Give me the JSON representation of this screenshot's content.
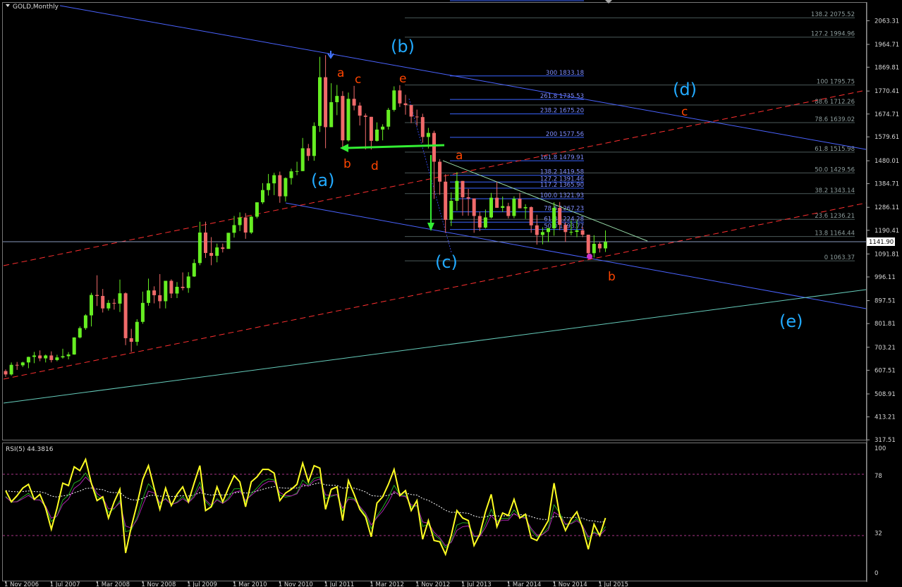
{
  "window": {
    "title": "GOLD,Monthly",
    "current_price": "1141.90",
    "rsi_title": "RSI(5) 44.3816"
  },
  "colors": {
    "background": "#000000",
    "bull_candle": "#66ee22",
    "bear_candle": "#f06a6a",
    "fib_line_grey": "#4b5a5a",
    "fib_line_blue": "#3a64ff",
    "fib_text_grey": "#8c9c9c",
    "fib_text_blue": "#7f8dff",
    "wave_major": "#22aaff",
    "wave_minor": "#ff4500",
    "channel_blue": "#4a63ff",
    "channel_red": "#ff3030",
    "trend_teal": "#66ccbb",
    "green_arrow": "#33ee33",
    "axis_text": "#d8d8d8",
    "rsi_main": "#ffff22",
    "rsi_signal": "#aa22aa",
    "rsi_green": "#22aa22",
    "rsi_level": "#ffdddd",
    "rsi_dotted": "#aa3388"
  },
  "chart_data": [
    {
      "type": "candlestick",
      "title": "GOLD,Monthly",
      "x_tick_labels": [
        "1 Nov 2006",
        "1 Jul 2007",
        "1 Mar 2008",
        "1 Nov 2008",
        "1 Jul 2009",
        "1 Mar 2010",
        "1 Nov 2010",
        "1 Jul 2011",
        "1 Mar 2012",
        "1 Nov 2012",
        "1 Jul 2013",
        "1 Mar 2014",
        "1 Nov 2014",
        "1 Jul 2015"
      ],
      "y_tick_labels": [
        "2063.31",
        "1964.71",
        "1869.81",
        "1770.41",
        "1674.71",
        "1579.61",
        "1480.01",
        "1384.71",
        "1286.11",
        "1190.41",
        "1091.81",
        "996.11",
        "897.51",
        "801.81",
        "703.21",
        "607.51",
        "508.91",
        "413.21",
        "317.51"
      ],
      "ylim": [
        300,
        2150
      ],
      "current_price": 1141.9,
      "ohlc": [
        [
          604,
          611,
          580,
          590
        ],
        [
          590,
          640,
          585,
          630
        ],
        [
          630,
          642,
          609,
          628
        ],
        [
          628,
          643,
          621,
          640
        ],
        [
          640,
          664,
          616,
          663
        ],
        [
          663,
          684,
          637,
          669
        ],
        [
          669,
          690,
          645,
          657
        ],
        [
          657,
          673,
          640,
          669
        ],
        [
          669,
          686,
          640,
          650
        ],
        [
          650,
          672,
          645,
          661
        ],
        [
          661,
          697,
          656,
          666
        ],
        [
          666,
          683,
          653,
          673
        ],
        [
          673,
          745,
          672,
          744
        ],
        [
          744,
          790,
          740,
          783
        ],
        [
          783,
          841,
          776,
          836
        ],
        [
          836,
          930,
          790,
          921
        ],
        [
          921,
          1003,
          875,
          917
        ],
        [
          917,
          946,
          848,
          865
        ],
        [
          865,
          900,
          856,
          888
        ],
        [
          888,
          905,
          860,
          885
        ],
        [
          885,
          985,
          850,
          928
        ],
        [
          928,
          932,
          712,
          741
        ],
        [
          741,
          780,
          684,
          726
        ],
        [
          726,
          820,
          710,
          809
        ],
        [
          809,
          935,
          801,
          888
        ],
        [
          888,
          989,
          876,
          940
        ],
        [
          940,
          957,
          886,
          920
        ],
        [
          920,
          1008,
          865,
          895
        ],
        [
          895,
          955,
          865,
          980
        ],
        [
          980,
          986,
          908,
          927
        ],
        [
          927,
          975,
          908,
          955
        ],
        [
          955,
          1015,
          940,
          950
        ],
        [
          950,
          1016,
          930,
          998
        ],
        [
          998,
          1070,
          996,
          1054
        ],
        [
          1054,
          1226,
          1045,
          1181
        ],
        [
          1181,
          1226,
          1075,
          1096
        ],
        [
          1096,
          1162,
          1045,
          1084
        ],
        [
          1084,
          1135,
          1057,
          1119
        ],
        [
          1119,
          1135,
          1098,
          1113
        ],
        [
          1113,
          1173,
          1113,
          1180
        ],
        [
          1180,
          1250,
          1160,
          1212
        ],
        [
          1212,
          1265,
          1187,
          1244
        ],
        [
          1244,
          1262,
          1155,
          1181
        ],
        [
          1181,
          1250,
          1175,
          1247
        ],
        [
          1247,
          1300,
          1240,
          1307
        ],
        [
          1307,
          1387,
          1300,
          1358
        ],
        [
          1358,
          1425,
          1335,
          1386
        ],
        [
          1386,
          1430,
          1337,
          1420
        ],
        [
          1420,
          1435,
          1305,
          1332
        ],
        [
          1332,
          1411,
          1310,
          1408
        ],
        [
          1408,
          1447,
          1381,
          1436
        ],
        [
          1436,
          1476,
          1420,
          1437
        ],
        [
          1437,
          1575,
          1460,
          1532
        ],
        [
          1532,
          1550,
          1480,
          1500
        ],
        [
          1500,
          1640,
          1480,
          1625
        ],
        [
          1625,
          1913,
          1600,
          1828
        ],
        [
          1828,
          1920,
          1532,
          1620
        ],
        [
          1620,
          1803,
          1625,
          1724
        ],
        [
          1724,
          1796,
          1670,
          1750
        ],
        [
          1750,
          1770,
          1530,
          1565
        ],
        [
          1565,
          1764,
          1560,
          1738
        ],
        [
          1738,
          1792,
          1690,
          1710
        ],
        [
          1710,
          1723,
          1627,
          1668
        ],
        [
          1668,
          1677,
          1527,
          1663
        ],
        [
          1663,
          1650,
          1527,
          1563
        ],
        [
          1563,
          1640,
          1560,
          1610
        ],
        [
          1610,
          1632,
          1565,
          1622
        ],
        [
          1622,
          1700,
          1610,
          1692
        ],
        [
          1692,
          1790,
          1685,
          1773
        ],
        [
          1773,
          1795,
          1704,
          1719
        ],
        [
          1719,
          1755,
          1672,
          1712
        ],
        [
          1712,
          1697,
          1637,
          1664
        ],
        [
          1664,
          1693,
          1626,
          1662
        ],
        [
          1662,
          1676,
          1555,
          1579
        ],
        [
          1579,
          1617,
          1531,
          1596
        ],
        [
          1596,
          1605,
          1321,
          1476
        ],
        [
          1476,
          1487,
          1338,
          1393
        ],
        [
          1393,
          1424,
          1180,
          1234
        ],
        [
          1234,
          1348,
          1208,
          1313
        ],
        [
          1313,
          1433,
          1272,
          1396
        ],
        [
          1396,
          1361,
          1251,
          1328
        ],
        [
          1328,
          1363,
          1251,
          1323
        ],
        [
          1323,
          1293,
          1180,
          1250
        ],
        [
          1250,
          1268,
          1187,
          1202
        ],
        [
          1202,
          1277,
          1198,
          1244
        ],
        [
          1244,
          1346,
          1240,
          1326
        ],
        [
          1326,
          1392,
          1321,
          1284
        ],
        [
          1284,
          1331,
          1267,
          1291
        ],
        [
          1291,
          1305,
          1240,
          1250
        ],
        [
          1250,
          1332,
          1241,
          1322
        ],
        [
          1322,
          1346,
          1291,
          1282
        ],
        [
          1282,
          1299,
          1238,
          1287
        ],
        [
          1287,
          1290,
          1180,
          1211
        ],
        [
          1211,
          1255,
          1131,
          1171
        ],
        [
          1171,
          1203,
          1132,
          1183
        ],
        [
          1183,
          1200,
          1141,
          1199
        ],
        [
          1199,
          1307,
          1168,
          1284
        ],
        [
          1284,
          1308,
          1191,
          1213
        ],
        [
          1213,
          1224,
          1142,
          1183
        ],
        [
          1183,
          1232,
          1170,
          1184
        ],
        [
          1184,
          1232,
          1162,
          1190
        ],
        [
          1190,
          1205,
          1162,
          1172
        ],
        [
          1172,
          1105,
          1077,
          1095
        ],
        [
          1095,
          1170,
          1077,
          1134
        ],
        [
          1134,
          1141,
          1098,
          1115
        ],
        [
          1115,
          1190,
          1100,
          1142
        ]
      ],
      "fibonacci_upper_right": [
        {
          "pct": "138.2",
          "price": "2075.52"
        },
        {
          "pct": "127.2",
          "price": "1994.96"
        },
        {
          "pct": "100",
          "price": "1795.75"
        },
        {
          "pct": "88.6",
          "price": "1712.26"
        },
        {
          "pct": "78.6",
          "price": "1639.02"
        },
        {
          "pct": "61.8",
          "price": "1515.98"
        },
        {
          "pct": "50.0",
          "price": "1429.56"
        },
        {
          "pct": "38.2",
          "price": "1343.14"
        },
        {
          "pct": "23.6",
          "price": "1236.21"
        },
        {
          "pct": "13.8",
          "price": "1164.44"
        },
        {
          "pct": "0",
          "price": "1063.37"
        }
      ],
      "fibonacci_extensions": [
        {
          "pct": "300",
          "price": "1833.18"
        },
        {
          "pct": "261.8",
          "price": "1735.53"
        },
        {
          "pct": "238.2",
          "price": "1675.20"
        },
        {
          "pct": "200",
          "price": "1577.56"
        },
        {
          "pct": "161.8",
          "price": "1479.91"
        },
        {
          "pct": "138.2",
          "price": "1419.58"
        },
        {
          "pct": "127.2",
          "price": "1391.46"
        },
        {
          "pct": "117.2",
          "price": "1365.90"
        },
        {
          "pct": "100.0",
          "price": "1321.93"
        },
        {
          "pct": "78.6",
          "price": "1267.23"
        },
        {
          "pct": "61.8",
          "price": "1224.28"
        },
        {
          "pct": "50.0",
          "price": "1193.77"
        }
      ],
      "wave_labels_major": [
        "(a)",
        "(b)",
        "(c)",
        "(d)",
        "(e)"
      ],
      "wave_labels_minor": [
        "a",
        "b",
        "c",
        "d",
        "e",
        "a",
        "c",
        "b"
      ]
    },
    {
      "type": "line",
      "title": "RSI(5) 44.3816",
      "y_tick_labels": [
        "100",
        "78",
        "32",
        "0"
      ],
      "ylim": [
        0,
        100
      ],
      "levels": [
        78,
        32
      ],
      "series": [
        {
          "name": "RSI(5)",
          "values": [
            66,
            57,
            62,
            68,
            71,
            59,
            63,
            52,
            35,
            52,
            72,
            70,
            85,
            82,
            91,
            72,
            58,
            61,
            44,
            57,
            67,
            16,
            37,
            55,
            75,
            86,
            68,
            51,
            68,
            54,
            63,
            69,
            57,
            72,
            86,
            50,
            53,
            69,
            57,
            68,
            78,
            73,
            53,
            73,
            77,
            83,
            83,
            80,
            58,
            64,
            67,
            71,
            88,
            73,
            86,
            84,
            51,
            67,
            69,
            42,
            74,
            63,
            51,
            45,
            29,
            56,
            61,
            71,
            83,
            62,
            66,
            50,
            58,
            27,
            42,
            26,
            25,
            15,
            30,
            50,
            44,
            42,
            22,
            31,
            49,
            63,
            37,
            48,
            46,
            59,
            44,
            47,
            28,
            26,
            34,
            42,
            72,
            46,
            34,
            43,
            49,
            36,
            19,
            39,
            30,
            44
          ]
        }
      ],
      "categories_span": "Nov 2006 – Aug 2015"
    }
  ]
}
